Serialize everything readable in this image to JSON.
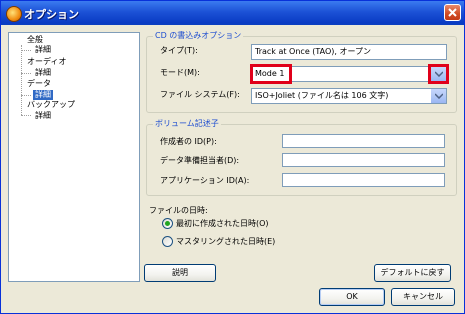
{
  "window": {
    "title": "オプション"
  },
  "tree": {
    "items": [
      {
        "label": "全般"
      },
      {
        "label": "詳細"
      },
      {
        "label": "オーディオ"
      },
      {
        "label": "詳細"
      },
      {
        "label": "データ"
      },
      {
        "label": "詳細"
      },
      {
        "label": "バックアップ"
      },
      {
        "label": "詳細"
      }
    ]
  },
  "cd_options": {
    "group_title": "CD の書込みオプション",
    "type_label": "タイプ(T):",
    "type_value": "Track at Once (TAO), オープン",
    "mode_label": "モード(M):",
    "mode_value": "Mode 1",
    "fs_label": "ファイル システム(F):",
    "fs_value": "ISO+Joliet (ファイル名は 106 文字)"
  },
  "volume": {
    "group_title": "ボリューム記述子",
    "author_label": "作成者の ID(P):",
    "preparer_label": "データ準備担当者(D):",
    "app_label": "アプリケーション ID(A):"
  },
  "file_date": {
    "label": "ファイルの日時:",
    "opt1": "最初に作成された日時(O)",
    "opt2": "マスタリングされた日時(E)"
  },
  "buttons": {
    "help": "説明",
    "defaults": "デフォルトに戻す",
    "ok": "OK",
    "cancel": "キャンセル"
  },
  "colors": {
    "highlight": "#e0001a",
    "titlebar": "#0a3cc4",
    "group_title": "#1c4cd0"
  }
}
